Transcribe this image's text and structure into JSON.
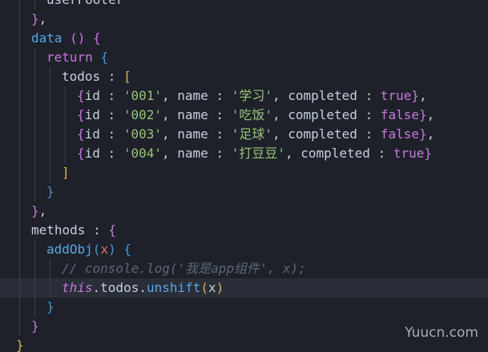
{
  "editor": {
    "current_line": "this.todos.unshift(x)",
    "lines": [
      {
        "indent": 2,
        "tokens": [
          {
            "t": "userFooter",
            "c": "t-plain"
          }
        ]
      },
      {
        "indent": 1,
        "tokens": [
          {
            "t": "}",
            "c": "b2"
          },
          {
            "t": ",",
            "c": "t-plain"
          }
        ]
      },
      {
        "indent": 1,
        "tokens": [
          {
            "t": "data",
            "c": "t-fn"
          },
          {
            "t": " ",
            "c": "t-plain"
          },
          {
            "t": "()",
            "c": "b2"
          },
          {
            "t": " ",
            "c": "t-plain"
          },
          {
            "t": "{",
            "c": "b2"
          }
        ]
      },
      {
        "indent": 2,
        "tokens": [
          {
            "t": "return",
            "c": "t-kw"
          },
          {
            "t": " ",
            "c": "t-plain"
          },
          {
            "t": "{",
            "c": "b3"
          }
        ]
      },
      {
        "indent": 3,
        "tokens": [
          {
            "t": "todos",
            "c": "t-plain"
          },
          {
            "t": " : ",
            "c": "t-plain"
          },
          {
            "t": "[",
            "c": "b1"
          }
        ]
      },
      {
        "indent": 4,
        "tokens": [
          {
            "t": "{",
            "c": "b2"
          },
          {
            "t": "id : ",
            "c": "t-plain"
          },
          {
            "t": "'001'",
            "c": "t-str"
          },
          {
            "t": ", name : ",
            "c": "t-plain"
          },
          {
            "t": "'学习'",
            "c": "t-str"
          },
          {
            "t": ", completed : ",
            "c": "t-plain"
          },
          {
            "t": "true",
            "c": "t-bool"
          },
          {
            "t": "}",
            "c": "b2"
          },
          {
            "t": ",",
            "c": "t-plain"
          }
        ]
      },
      {
        "indent": 4,
        "tokens": [
          {
            "t": "{",
            "c": "b2"
          },
          {
            "t": "id : ",
            "c": "t-plain"
          },
          {
            "t": "'002'",
            "c": "t-str"
          },
          {
            "t": ", name : ",
            "c": "t-plain"
          },
          {
            "t": "'吃饭'",
            "c": "t-str"
          },
          {
            "t": ", completed : ",
            "c": "t-plain"
          },
          {
            "t": "false",
            "c": "t-bool"
          },
          {
            "t": "}",
            "c": "b2"
          },
          {
            "t": ",",
            "c": "t-plain"
          }
        ]
      },
      {
        "indent": 4,
        "tokens": [
          {
            "t": "{",
            "c": "b2"
          },
          {
            "t": "id : ",
            "c": "t-plain"
          },
          {
            "t": "'003'",
            "c": "t-str"
          },
          {
            "t": ", name : ",
            "c": "t-plain"
          },
          {
            "t": "'足球'",
            "c": "t-str"
          },
          {
            "t": ", completed : ",
            "c": "t-plain"
          },
          {
            "t": "false",
            "c": "t-bool"
          },
          {
            "t": "}",
            "c": "b2"
          },
          {
            "t": ",",
            "c": "t-plain"
          }
        ]
      },
      {
        "indent": 4,
        "tokens": [
          {
            "t": "{",
            "c": "b2"
          },
          {
            "t": "id : ",
            "c": "t-plain"
          },
          {
            "t": "'004'",
            "c": "t-str"
          },
          {
            "t": ", name : ",
            "c": "t-plain"
          },
          {
            "t": "'打豆豆'",
            "c": "t-str"
          },
          {
            "t": ", completed : ",
            "c": "t-plain"
          },
          {
            "t": "true",
            "c": "t-bool"
          },
          {
            "t": "}",
            "c": "b2"
          }
        ]
      },
      {
        "indent": 3,
        "tokens": [
          {
            "t": "]",
            "c": "b1"
          }
        ]
      },
      {
        "indent": 2,
        "tokens": [
          {
            "t": "}",
            "c": "b3"
          }
        ]
      },
      {
        "indent": 1,
        "tokens": [
          {
            "t": "}",
            "c": "b2"
          },
          {
            "t": ",",
            "c": "t-plain"
          }
        ]
      },
      {
        "indent": 1,
        "tokens": [
          {
            "t": "methods",
            "c": "t-plain"
          },
          {
            "t": " : ",
            "c": "t-plain"
          },
          {
            "t": "{",
            "c": "b2"
          }
        ]
      },
      {
        "indent": 2,
        "tokens": [
          {
            "t": "addObj",
            "c": "t-fn"
          },
          {
            "t": "(",
            "c": "b3"
          },
          {
            "t": "x",
            "c": "t-param"
          },
          {
            "t": ")",
            "c": "b3"
          },
          {
            "t": " ",
            "c": "t-plain"
          },
          {
            "t": "{",
            "c": "b3"
          }
        ]
      },
      {
        "indent": 3,
        "tokens": [
          {
            "t": "// console.log('我是app组件', x);",
            "c": "t-comment"
          }
        ]
      },
      {
        "indent": 3,
        "current": true,
        "tokens": [
          {
            "t": "this",
            "c": "t-this"
          },
          {
            "t": ".todos.",
            "c": "t-plain"
          },
          {
            "t": "unshift",
            "c": "t-fn"
          },
          {
            "t": "(",
            "c": "b1"
          },
          {
            "t": "x",
            "c": "t-plain"
          },
          {
            "t": ")",
            "c": "b1"
          }
        ]
      },
      {
        "indent": 2,
        "tokens": [
          {
            "t": "}",
            "c": "b3"
          }
        ]
      },
      {
        "indent": 1,
        "tokens": [
          {
            "t": "}",
            "c": "b2"
          }
        ]
      },
      {
        "indent": 0,
        "tokens": [
          {
            "t": "}",
            "c": "b1"
          }
        ]
      }
    ]
  },
  "watermark": "Yuucn.com"
}
